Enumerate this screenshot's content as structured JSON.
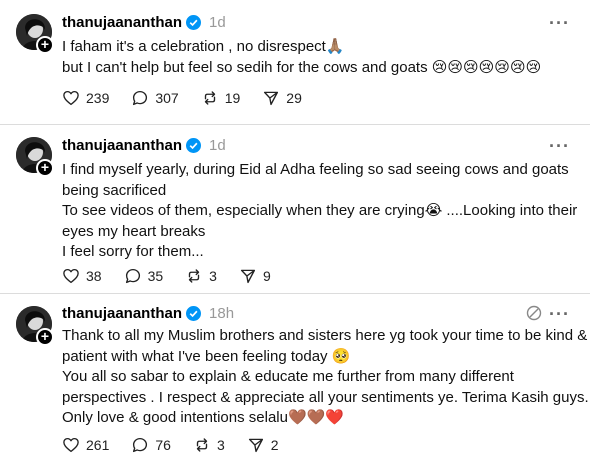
{
  "posts": [
    {
      "username": "thanujaananthan",
      "time": "1d",
      "lines": [
        "I faham it's a celebration , no disrespect🙏🏽",
        "but I can't help but feel so sedih for the cows and goats 😢😢😢😢😢😢😢"
      ],
      "likes": "239",
      "replies": "307",
      "reposts": "19",
      "shares": "29"
    },
    {
      "username": "thanujaananthan",
      "time": "1d",
      "lines": [
        "I find myself yearly, during Eid al Adha feeling so sad seeing cows and goats",
        "being sacrificed",
        "To see videos of them, especially when they are crying😭 ....Looking into their",
        "eyes my heart breaks",
        "I feel sorry for them..."
      ],
      "likes": "38",
      "replies": "35",
      "reposts": "3",
      "shares": "9"
    },
    {
      "username": "thanujaananthan",
      "time": "18h",
      "lines": [
        "Thank to all my Muslim brothers and sisters here yg took your time to be kind &",
        "patient with what I've been feeling today 🥺",
        "You all so sabar to explain & educate me further from many different",
        "perspectives . I respect & appreciate all your sentiments ye. Terima Kasih guys.",
        "Only love & good intentions selalu🤎🤎❤️"
      ],
      "likes": "261",
      "replies": "76",
      "reposts": "3",
      "shares": "2"
    }
  ],
  "icons": {
    "more": "more-icon",
    "verified": "verified-badge-icon",
    "like": "heart-icon",
    "reply": "comment-icon",
    "repost": "repost-icon",
    "share": "share-icon",
    "translate": "translate-icon",
    "follow": "follow-plus-icon"
  },
  "colors": {
    "verified": "#0095f6",
    "muted": "#999999",
    "divider": "#dcdcdc"
  },
  "more_label": "···"
}
